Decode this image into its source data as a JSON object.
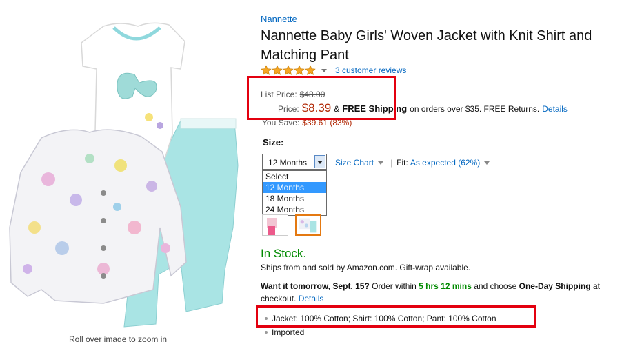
{
  "product": {
    "brand": "Nannette",
    "title": "Nannette Baby Girls' Woven Jacket with Knit Shirt and Matching Pant",
    "rating": 5,
    "reviews_label": "3 customer reviews",
    "image_caption": "Roll over image to zoom in"
  },
  "pricing": {
    "list_label": "List Price:",
    "list_value": "$48.00",
    "price_label": "Price:",
    "price_value": "$8.39",
    "shipping_amp": "&",
    "shipping_bold": "FREE Shipping",
    "shipping_rest": "on orders over $35. FREE Returns.",
    "details_link": "Details",
    "save_label": "You Save:",
    "save_value": "$39.61 (83%)"
  },
  "size": {
    "label": "Size:",
    "selected": "12 Months",
    "options": [
      "Select",
      "12 Months",
      "18 Months",
      "24 Months"
    ],
    "selected_index": 1,
    "size_chart": "Size Chart",
    "fit_label": "Fit:",
    "fit_value": "As expected (62%)"
  },
  "availability": {
    "status": "In Stock.",
    "ships_from": "Ships from and sold by Amazon.com. Gift-wrap available.",
    "want_bold": "Want it tomorrow, Sept. 15?",
    "order_within": "Order within",
    "time_left": "5 hrs 12 mins",
    "choose": "and choose",
    "one_day": "One-Day Shipping",
    "at_checkout": "at checkout.",
    "details_link": "Details"
  },
  "features": [
    "Jacket: 100% Cotton; Shirt: 100% Cotton; Pant: 100% Cotton",
    "Imported"
  ],
  "colors": {
    "link": "#0066c0",
    "price": "#b12704",
    "instock": "#008a00",
    "highlight_box": "#e3000f"
  }
}
